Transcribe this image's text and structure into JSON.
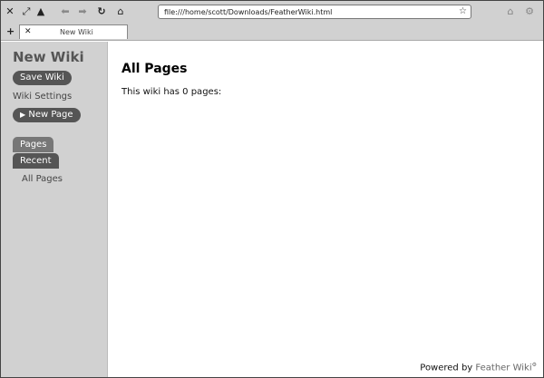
{
  "browser": {
    "url": "file:///home/scott/Downloads/FeatherWiki.html",
    "toolbar_icons": [
      "close-icon",
      "resize-icon",
      "eject-icon",
      "back-icon",
      "forward-icon",
      "reload-icon",
      "home-icon",
      "bookmark-star-icon",
      "downloads-icon",
      "settings-icon"
    ],
    "tab": {
      "title": "New Wiki"
    }
  },
  "sidebar": {
    "wiki_title": "New Wiki",
    "save_label": "Save Wiki",
    "settings_label": "Wiki Settings",
    "new_page_label": "New Page",
    "tabs": [
      {
        "label": "Pages"
      },
      {
        "label": "Recent"
      }
    ],
    "links": [
      {
        "label": "All Pages"
      }
    ]
  },
  "main": {
    "heading": "All Pages",
    "description": "This wiki has 0 pages:"
  },
  "footer": {
    "prefix": "Powered by ",
    "link": "Feather Wiki"
  }
}
